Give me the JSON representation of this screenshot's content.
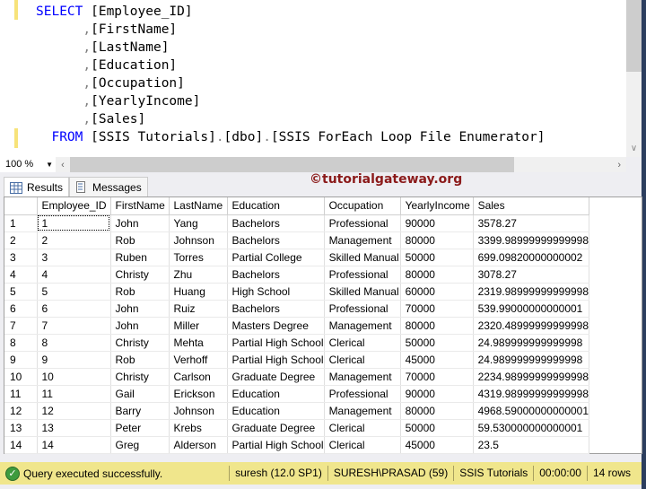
{
  "editor": {
    "lines": [
      {
        "kw": "SELECT",
        "text": " [Employee_ID]"
      },
      {
        "comma": ",",
        "text": "[FirstName]"
      },
      {
        "comma": ",",
        "text": "[LastName]"
      },
      {
        "comma": ",",
        "text": "[Education]"
      },
      {
        "comma": ",",
        "text": "[Occupation]"
      },
      {
        "comma": ",",
        "text": "[YearlyIncome]"
      },
      {
        "comma": ",",
        "text": "[Sales]"
      }
    ],
    "from": {
      "kw": "FROM",
      "p1": "[SSIS Tutorials]",
      "dot1": ".",
      "p2": "[dbo]",
      "dot2": ".",
      "p3": "[SSIS ForEach Loop File Enumerator]"
    }
  },
  "zoom": {
    "value": "100 %"
  },
  "tabs": [
    {
      "label": "Results",
      "icon": "grid-icon"
    },
    {
      "label": "Messages",
      "icon": "messages-icon"
    }
  ],
  "watermark": "©tutorialgateway.org",
  "grid": {
    "columns": [
      "Employee_ID",
      "FirstName",
      "LastName",
      "Education",
      "Occupation",
      "YearlyIncome",
      "Sales"
    ],
    "rows": [
      [
        "1",
        "1",
        "John",
        "Yang",
        "Bachelors",
        "Professional",
        "90000",
        "3578.27"
      ],
      [
        "2",
        "2",
        "Rob",
        "Johnson",
        "Bachelors",
        "Management",
        "80000",
        "3399.98999999999998"
      ],
      [
        "3",
        "3",
        "Ruben",
        "Torres",
        "Partial College",
        "Skilled Manual",
        "50000",
        "699.09820000000002"
      ],
      [
        "4",
        "4",
        "Christy",
        "Zhu",
        "Bachelors",
        "Professional",
        "80000",
        "3078.27"
      ],
      [
        "5",
        "5",
        "Rob",
        "Huang",
        "High School",
        "Skilled Manual",
        "60000",
        "2319.98999999999998"
      ],
      [
        "6",
        "6",
        "John",
        "Ruiz",
        "Bachelors",
        "Professional",
        "70000",
        "539.99000000000001"
      ],
      [
        "7",
        "7",
        "John",
        "Miller",
        "Masters Degree",
        "Management",
        "80000",
        "2320.48999999999998"
      ],
      [
        "8",
        "8",
        "Christy",
        "Mehta",
        "Partial High School",
        "Clerical",
        "50000",
        "24.989999999999998"
      ],
      [
        "9",
        "9",
        "Rob",
        "Verhoff",
        "Partial High School",
        "Clerical",
        "45000",
        "24.989999999999998"
      ],
      [
        "10",
        "10",
        "Christy",
        "Carlson",
        "Graduate Degree",
        "Management",
        "70000",
        "2234.98999999999998"
      ],
      [
        "11",
        "11",
        "Gail",
        "Erickson",
        "Education",
        "Professional",
        "90000",
        "4319.98999999999998"
      ],
      [
        "12",
        "12",
        "Barry",
        "Johnson",
        "Education",
        "Management",
        "80000",
        "4968.59000000000001"
      ],
      [
        "13",
        "13",
        "Peter",
        "Krebs",
        "Graduate Degree",
        "Clerical",
        "50000",
        "59.530000000000001"
      ],
      [
        "14",
        "14",
        "Greg",
        "Alderson",
        "Partial High School",
        "Clerical",
        "45000",
        "23.5"
      ]
    ]
  },
  "status": {
    "message": "Query executed successfully.",
    "server": "suresh (12.0 SP1)",
    "user": "SURESH\\PRASAD (59)",
    "database": "SSIS Tutorials",
    "time": "00:00:00",
    "rows": "14 rows",
    "color": "#f0e68c"
  }
}
